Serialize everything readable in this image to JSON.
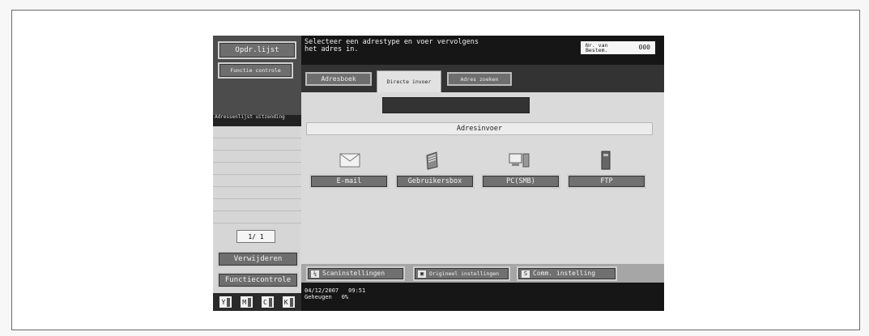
{
  "sidebar": {
    "job_list": "Opdr.lijst",
    "check_job": "Functie controle",
    "list_header": "Adressenlijst uitzending",
    "page": "1/ 1",
    "delete": "Verwijderen",
    "function_check": "Functiecontrole",
    "toner": [
      "Y",
      "M",
      "C",
      "K"
    ]
  },
  "message": {
    "line1": "Selecteer een adrestype en voer vervolgens",
    "line2": "het adres in.",
    "counter_label_1": "Nr. van",
    "counter_label_2": "Bestem.",
    "counter_value": "000"
  },
  "tabs": [
    {
      "label": "Adresboek"
    },
    {
      "label": "Directe invoer"
    },
    {
      "label": "Adres zoeken"
    }
  ],
  "section_title": "Adresinvoer",
  "destinations": [
    {
      "label": "E-mail",
      "icon": "mail-icon"
    },
    {
      "label": "Gebruikersbox",
      "icon": "box-icon"
    },
    {
      "label": "PC(SMB)",
      "icon": "pc-icon"
    },
    {
      "label": "FTP",
      "icon": "server-icon"
    }
  ],
  "bottom_buttons": [
    {
      "label": "Scaninstellingen"
    },
    {
      "label": "Origineel instellingen"
    },
    {
      "label": "Comm. instelling"
    }
  ],
  "status": {
    "date": "04/12/2007",
    "time": "09:51",
    "memory_label": "Geheugen",
    "memory_value": "0%"
  }
}
